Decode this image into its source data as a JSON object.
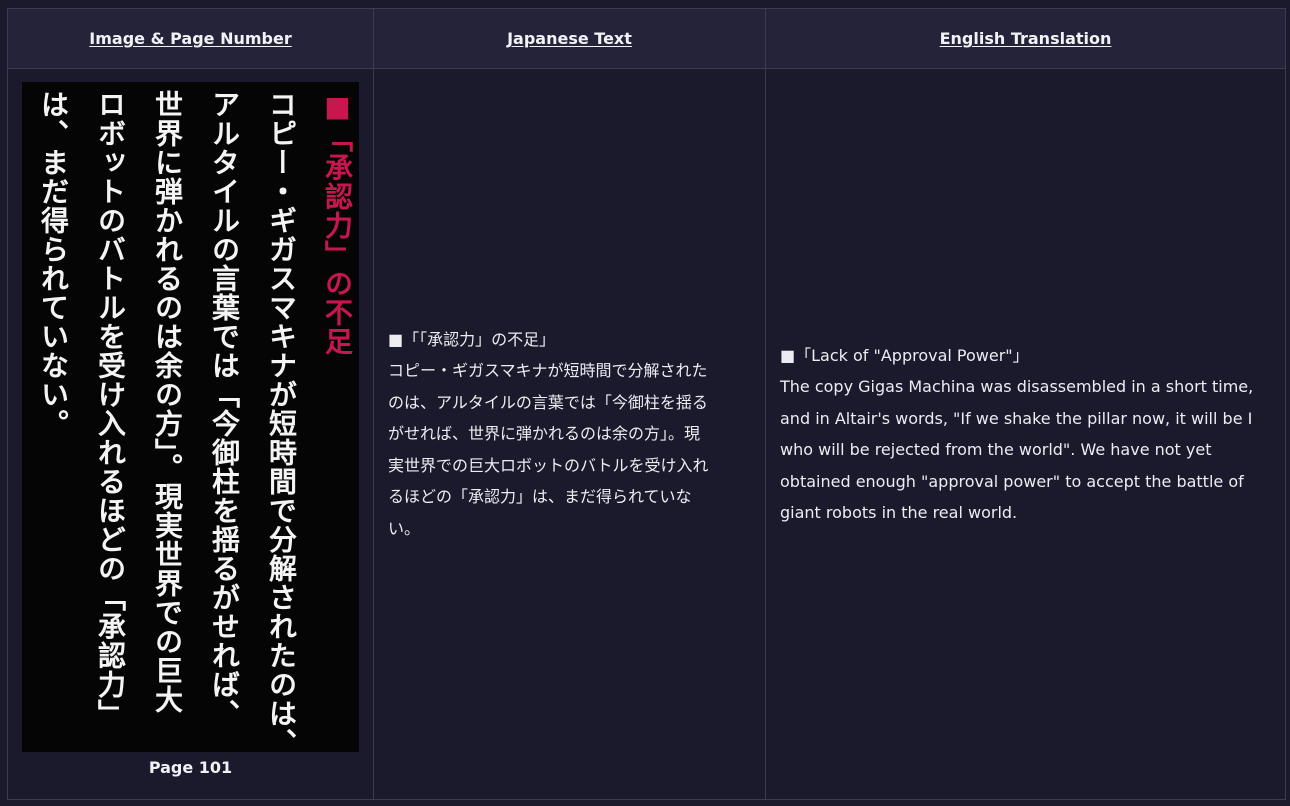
{
  "table": {
    "headers": {
      "image": "Image & Page Number",
      "japanese": "Japanese Text",
      "english": "English Translation"
    }
  },
  "image": {
    "vertical_columns": [
      "■「承認力」の不足",
      "コピー・ギガスマキナが短時間で分解されたのは、",
      "アルタイルの言葉では「今御柱を揺るがせれば、",
      "世界に弾かれるのは余の方」。現実世界での巨大",
      "ロボットのバトルを受け入れるほどの「承認力」",
      "は、まだ得られていない。"
    ],
    "heading_color": "#c8174f",
    "page_number": "Page 101"
  },
  "japanese": {
    "lines": [
      "■「「承認力」の不足」",
      "コピー・ギガスマキナが短時間で分解された",
      "のは、アルタイルの言葉では「今御柱を揺る",
      "がせれば、世界に弾かれるのは余の方」。現",
      "実世界での巨大ロボットのバトルを受け入れ",
      "るほどの「承認力」は、まだ得られていな",
      "い。"
    ]
  },
  "english": {
    "lines": [
      "■「Lack of \"Approval Power\"」",
      "The copy Gigas Machina was disassembled in a short time,",
      "and in Altair's words, \"If we shake the pillar now, it will be I",
      "who will be rejected from the world\". We have not yet",
      "obtained enough \"approval power\" to accept the battle of",
      "giant robots in the real world."
    ]
  }
}
